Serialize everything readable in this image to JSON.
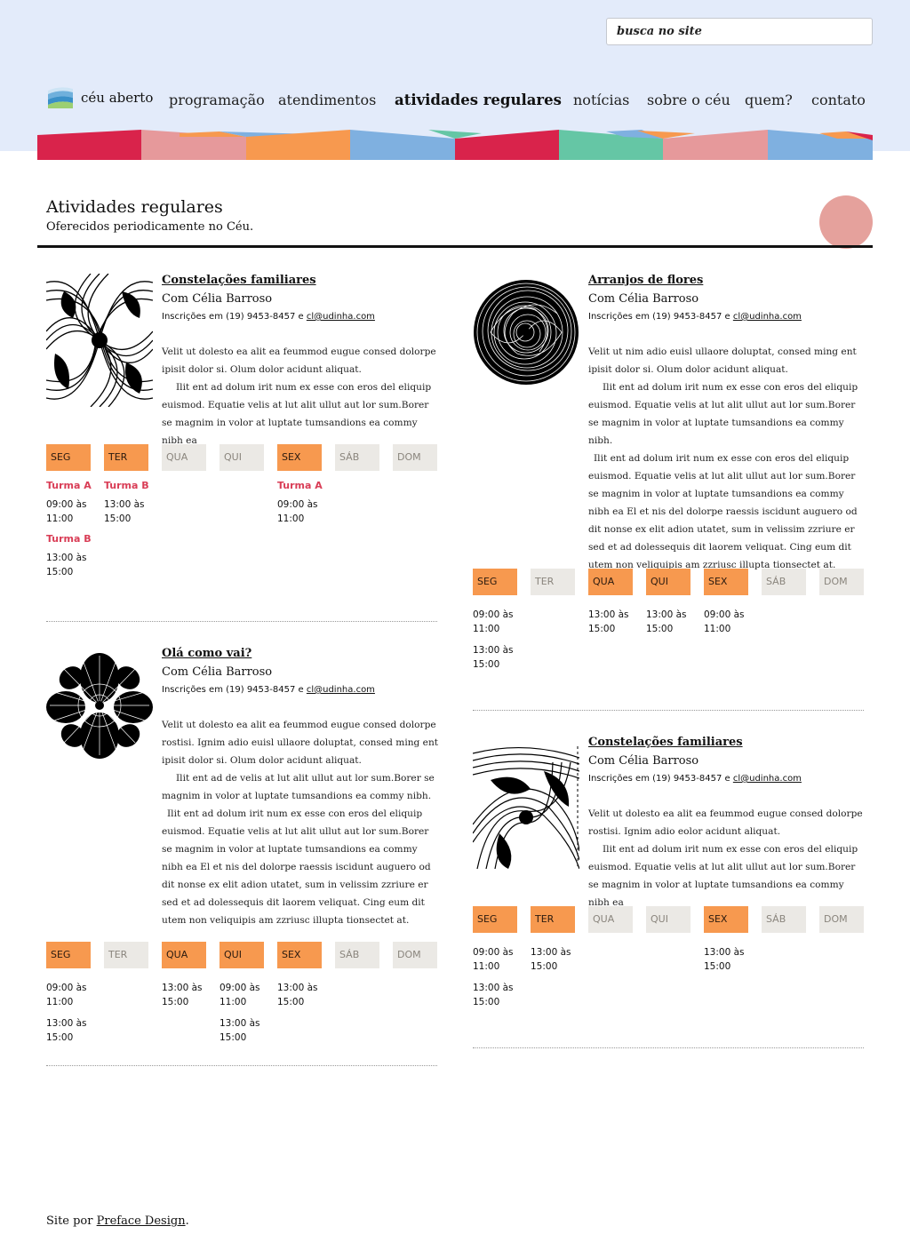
{
  "search": {
    "placeholder": "busca no site"
  },
  "brand": {
    "name": "céu aberto",
    "icon": "sky-logo-icon"
  },
  "nav": {
    "items": [
      {
        "label": "programação"
      },
      {
        "label": "atendimentos"
      },
      {
        "label": "atividades regulares",
        "active": true
      },
      {
        "label": "notícias"
      },
      {
        "label": "sobre o céu"
      },
      {
        "label": "quem?"
      },
      {
        "label": "contato"
      }
    ]
  },
  "colors": {
    "accent_orange": "#f7994f",
    "stripe_red": "#d9234b",
    "stripe_pink": "#e6999b",
    "stripe_blue": "#7fb0e0",
    "stripe_green": "#65c6a5",
    "turma_red": "#d93d56"
  },
  "header": {
    "title": "Atividades regulares",
    "subtitle": "Oferecidos periodicamente no Céu."
  },
  "days": [
    "SEG",
    "TER",
    "QUA",
    "QUI",
    "SEX",
    "SÁB",
    "DOM"
  ],
  "cards": [
    {
      "title": "Constelações familiares",
      "author": "Com Célia Barroso",
      "contact_prefix": "Inscrições em (19) 9453-8457 e ",
      "email": "cl@udinha.com",
      "image": "spiral-pattern-image",
      "desc": [
        "Velit ut dolesto ea alit ea feummod eugue consed dolorpe ipisit dolor si. Olum dolor acidunt aliquat.",
        "Ilit ent ad dolum irit num ex esse con eros del eliquip euismod. Equatie velis at lut alit ullut aut lor sum.Borer se magnim in volor at luptate tumsandions ea commy nibh ea"
      ],
      "active_days": [
        true,
        true,
        false,
        false,
        true,
        false,
        false
      ],
      "schedule": [
        {
          "turma": "Turma A",
          "time": "09:00 às 11:00"
        },
        {
          "turma": "Turma B",
          "time": "13:00 às 15:00"
        },
        {
          "turma": "Turma B",
          "time": "13:00 às 15:00"
        },
        {
          "turma": "Turma A",
          "time": "09:00 às 11:00"
        }
      ]
    },
    {
      "title": "Arranjos de flores",
      "author": "Com Célia Barroso",
      "contact_prefix": "Inscrições em (19) 9453-8457 e ",
      "email": "cl@udinha.com",
      "image": "vortex-circle-image",
      "desc": [
        "Velit ut nim adio euisl ullaore doluptat, consed ming ent ipisit dolor si. Olum dolor acidunt aliquat.",
        "Ilit ent ad dolum irit num ex esse con eros del eliquip euismod. Equatie velis at lut alit ullut aut lor sum.Borer se magnim in volor at luptate tumsandions ea commy nibh.",
        "Ilit ent ad dolum irit num ex esse con eros del eliquip euismod. Equatie velis at lut alit ullut aut lor sum.Borer se magnim in volor at luptate tumsandions ea commy nibh ea El et nis del dolorpe raessis iscidunt auguero od dit nonse ex elit adion utatet, sum in velissim zzriure er sed et ad dolessequis dit laorem veliquat. Cing eum dit utem non veliquipis am zzriusc illupta tionsectet at."
      ],
      "active_days": [
        true,
        false,
        true,
        true,
        true,
        false,
        false
      ],
      "schedule": [
        "09:00 às 11:00",
        "13:00 às 15:00",
        "13:00 às 15:00",
        "13:00 às 15:00",
        "09:00 às 11:00"
      ]
    },
    {
      "title": "Olá como vai?",
      "author": "Com Célia Barroso",
      "contact_prefix": "Inscrições em (19) 9453-8457 e ",
      "email": "cl@udinha.com",
      "image": "flower-pattern-image",
      "desc": [
        "Velit ut dolesto ea alit ea feummod eugue consed dolorpe rostisi. Ignim adio euisl ullaore doluptat, consed ming ent ipisit dolor si. Olum dolor acidunt aliquat.",
        "Ilit ent ad de velis at lut alit ullut aut lor sum.Borer se magnim in volor at luptate tumsandions ea commy nibh.",
        "Ilit ent ad dolum irit num ex esse con eros del eliquip euismod. Equatie velis at lut alit ullut aut lor sum.Borer se magnim in volor at luptate tumsandions ea commy nibh ea El et nis del dolorpe raessis iscidunt auguero od dit nonse ex elit adion utatet, sum in velissim zzriure er sed et ad dolessequis dit laorem veliquat. Cing eum dit utem non veliquipis am zzriusc illupta tionsectet at."
      ],
      "active_days": [
        true,
        false,
        true,
        true,
        true,
        false,
        false
      ],
      "schedule": [
        "09:00 às 11:00",
        "13:00 às 15:00",
        "13:00 às 15:00",
        "09:00 às 11:00",
        "13:00 às 15:00",
        "13:00 às 15:00"
      ]
    },
    {
      "title": "Constelações familiares",
      "author": "Com Célia Barroso",
      "contact_prefix": "Inscrições em (19) 9453-8457 e ",
      "email": "cl@udinha.com",
      "image": "swirl-pattern-image",
      "desc": [
        "Velit ut dolesto ea alit ea feummod eugue consed dolorpe rostisi. Ignim adio eolor acidunt aliquat.",
        "Ilit ent ad dolum irit num ex esse con eros del eliquip euismod. Equatie velis at lut alit ullut aut lor sum.Borer se magnim in volor at luptate tumsandions ea commy nibh ea"
      ],
      "active_days": [
        true,
        true,
        false,
        false,
        true,
        false,
        false
      ],
      "schedule": [
        "09:00 às 11:00",
        "13:00 às 15:00",
        "13:00 às 15:00",
        "13:00 às 15:00"
      ]
    }
  ],
  "footer": {
    "prefix": "Site por ",
    "link": "Preface Design",
    "suffix": "."
  }
}
